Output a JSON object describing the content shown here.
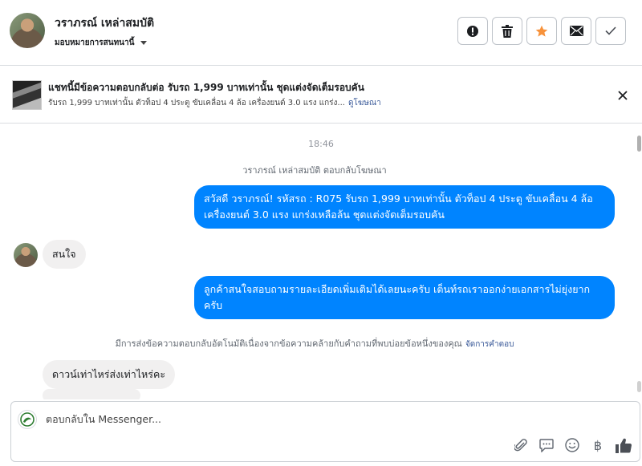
{
  "header": {
    "contact_name": "วราภรณ์ เหล่าสมบัติ",
    "assign_label": "มอบหมายการสนทนานี้",
    "actions": [
      {
        "icon": "alert-icon"
      },
      {
        "icon": "trash-icon"
      },
      {
        "icon": "star-icon"
      },
      {
        "icon": "mail-icon"
      },
      {
        "icon": "check-icon"
      }
    ],
    "colors": {
      "star": "#f7923b"
    }
  },
  "ad": {
    "title": "แชทนี้มีข้อความตอบกลับต่อ รับรถ 1,999 บาทเท่านั้น ชุดแต่งจัดเต็มรอบคัน",
    "description": "รับรถ 1,999 บาทเท่านั้น ตัวท็อป 4 ประตู ขับเคลื่อน 4 ล้อ เครื่องยนต์ 3.0 แรง แกร่ง...",
    "link": "ดูโฆษณา"
  },
  "conversation": {
    "time": "18:46",
    "reply_note": "วราภรณ์ เหล่าสมบัติ ตอบกลับโฆษณา",
    "outgoing_1": "สวัสดี วราภรณ์! รหัสรถ : R075 รับรถ 1,999 บาทเท่านั้น ตัวท็อป 4 ประตู ขับเคลื่อน 4 ล้อ  เครื่องยนต์ 3.0 แรง แกร่งเหลือล้น ชุดแต่งจัดเต็มรอบคัน",
    "incoming_1": "สนใจ",
    "outgoing_2": "ลูกค้าสนใจสอบถามรายละเอียดเพิ่มเติมได้เลยนะครับ เต็นท์รถเราออกง่ายเอกสารไม่ยุ่งยากครับ",
    "auto_note": "มีการส่งข้อความตอบกลับอัตโนมัติเนื่องจากข้อความคล้ายกับคำถามที่พบบ่อยข้อหนึ่งของคุณ",
    "auto_link": "จัดการคำตอบ",
    "incoming_2": "ดาวน์เท่าไหร่ส่งเท่าไหร่คะ",
    "colors": {
      "outgoing": "#0084ff",
      "incoming": "#f1f0f0"
    }
  },
  "composer": {
    "placeholder": "ตอบกลับใน Messenger...",
    "tools": [
      "attach-icon",
      "saved-reply-icon",
      "emoji-icon",
      "baht-icon",
      "like-icon"
    ],
    "baht_symbol": "฿"
  }
}
